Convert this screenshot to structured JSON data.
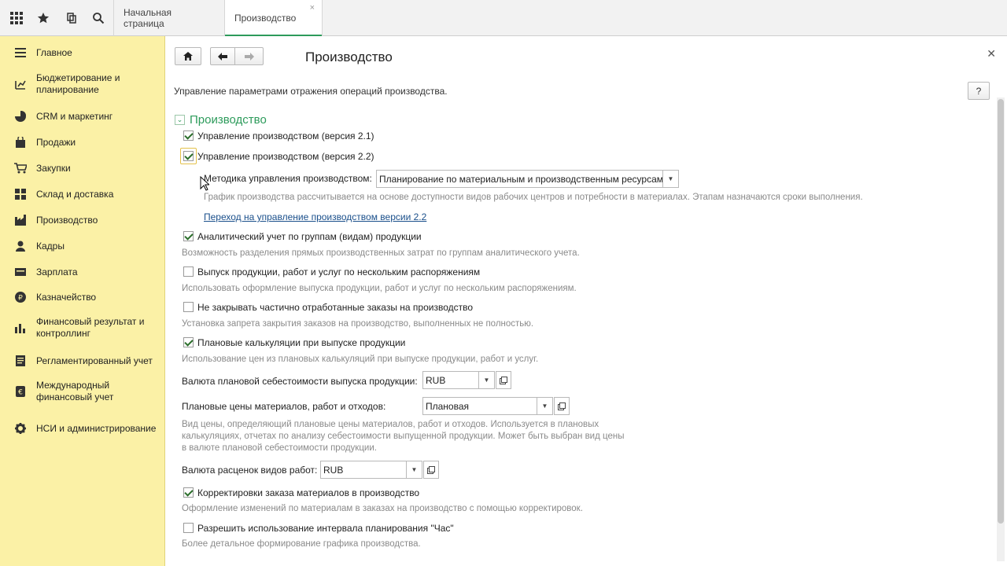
{
  "tabs": [
    {
      "label": "Начальная страница"
    },
    {
      "label": "Производство",
      "active": true
    }
  ],
  "sidebar": {
    "items": [
      {
        "icon": "menu-lines-icon",
        "label": "Главное"
      },
      {
        "icon": "budget-icon",
        "label": "Бюджетирование и планирование"
      },
      {
        "icon": "pie-chart-icon",
        "label": "CRM и маркетинг"
      },
      {
        "icon": "shopping-bag-icon",
        "label": "Продажи"
      },
      {
        "icon": "cart-icon",
        "label": "Закупки"
      },
      {
        "icon": "warehouse-icon",
        "label": "Склад и доставка"
      },
      {
        "icon": "factory-icon",
        "label": "Производство"
      },
      {
        "icon": "person-icon",
        "label": "Кадры"
      },
      {
        "icon": "salary-icon",
        "label": "Зарплата"
      },
      {
        "icon": "treasury-icon",
        "label": "Казначейство"
      },
      {
        "icon": "bar-chart-icon",
        "label": "Финансовый результат и контроллинг"
      },
      {
        "icon": "document-icon",
        "label": "Регламентированный учет"
      },
      {
        "icon": "euro-icon",
        "label": "Международный финансовый учет"
      },
      {
        "icon": "gear-icon",
        "label": "НСИ и администрирование"
      }
    ]
  },
  "page": {
    "title": "Производство",
    "help_label": "?",
    "description": "Управление параметрами отражения операций производства.",
    "section_title": "Производство"
  },
  "options": {
    "v21": {
      "label": "Управление производством (версия 2.1)",
      "checked": true
    },
    "v22": {
      "label": "Управление производством (версия 2.2)",
      "checked": true
    },
    "method_label": "Методика управления производством:",
    "method_value": "Планирование по материальным и производственным ресурсам",
    "method_hint": "График производства рассчитывается на основе доступности видов рабочих центров и потребности в материалах. Этапам назначаются сроки выполнения.",
    "switch_link": "Переход на управление производством версии 2.2",
    "analytic": {
      "label": "Аналитический учет по группам (видам) продукции",
      "checked": true,
      "hint": "Возможность разделения прямых производственных затрат по группам аналитического учета."
    },
    "release": {
      "label": "Выпуск продукции, работ и услуг по нескольким распоряжениям",
      "checked": false,
      "hint": "Использовать оформление выпуска продукции, работ и услуг по нескольким распоряжениям."
    },
    "noclose": {
      "label": "Не закрывать частично отработанные заказы на производство",
      "checked": false,
      "hint": "Установка запрета закрытия заказов на производство, выполненных не полностью."
    },
    "plan_calc": {
      "label": "Плановые калькуляции при выпуске продукции",
      "checked": true,
      "hint": "Использование цен из плановых калькуляций при выпуске продукции, работ и услуг."
    },
    "plan_currency_label": "Валюта плановой себестоимости выпуска продукции:",
    "plan_currency_value": "RUB",
    "plan_prices_label": "Плановые цены материалов, работ и отходов:",
    "plan_prices_value": "Плановая",
    "plan_prices_hint": "Вид цены, определяющий плановые цены материалов, работ и отходов. Используется в плановых калькуляциях, отчетах по анализу себестоимости выпущенной продукции. Может быть выбран вид цены в валюте плановой себестоимости продукции.",
    "rate_currency_label": "Валюта расценок видов работ:",
    "rate_currency_value": "RUB",
    "corrections": {
      "label": "Корректировки заказа материалов в производство",
      "checked": true,
      "hint": "Оформление изменений по материалам в заказах на производство с помощью корректировок."
    },
    "hour_interval": {
      "label": "Разрешить использование интервала планирования \"Час\"",
      "checked": false,
      "hint": "Более детальное формирование графика производства."
    }
  }
}
